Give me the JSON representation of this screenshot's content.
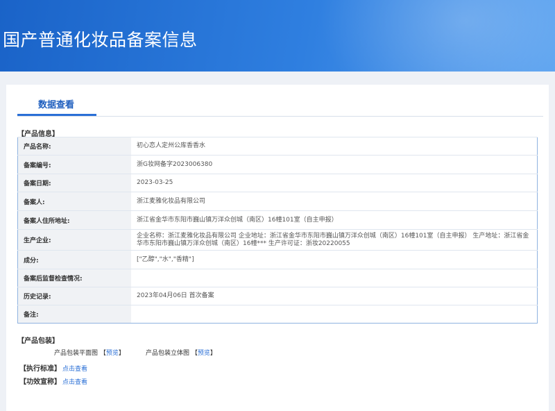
{
  "header": {
    "title": "国产普通化妆品备案信息"
  },
  "tabs": [
    {
      "label": "数据查看"
    }
  ],
  "product_info": {
    "section_label": "【产品信息】",
    "rows": [
      {
        "key": "产品名称:",
        "value": "初心恋人定州公库香香水"
      },
      {
        "key": "备案编号:",
        "value": "浙G妆网备字2023006380"
      },
      {
        "key": "备案日期:",
        "value": "2023-03-25"
      },
      {
        "key": "备案人:",
        "value": "浙江麦雅化妆品有限公司"
      },
      {
        "key": "备案人住所地址:",
        "value": "浙江省金华市东阳市巍山镇万洋众创城（南区）16幢101室（自主申报）"
      },
      {
        "key": "生产企业:",
        "value": "企业名称：浙江麦雅化妆品有限公司 企业地址：浙江省金华市东阳市巍山镇万洋众创城（南区）16幢101室（自主申报） 生产地址：浙江省金华市东阳市巍山镇万洋众创城（南区）16幢*** 生产许可证：浙妆20220055"
      },
      {
        "key": "成分:",
        "value": "[\"乙醇\",\"水\",\"香精\"]"
      },
      {
        "key": "备案后监督检查情况:",
        "value": ""
      },
      {
        "key": "历史记录:",
        "value": "2023年04月06日 首次备案"
      },
      {
        "key": "备注:",
        "value": ""
      }
    ]
  },
  "packaging": {
    "section_label": "【产品包装】",
    "items": [
      {
        "label": "产品包装平面图",
        "bracket_open": "【",
        "link": "预览",
        "bracket_close": "】"
      },
      {
        "label": "产品包装立体图",
        "bracket_open": "【",
        "link": "预览",
        "bracket_close": "】"
      }
    ]
  },
  "standard": {
    "label": "【执行标准】",
    "link": "点击查看"
  },
  "efficacy": {
    "label": "【功效宣称】",
    "link": "点击查看"
  },
  "colors": {
    "banner": "#2f7fe0",
    "accent": "#2a6fd6",
    "key_bg": "#f0f2f5",
    "table_border": "#8fb3e0"
  }
}
